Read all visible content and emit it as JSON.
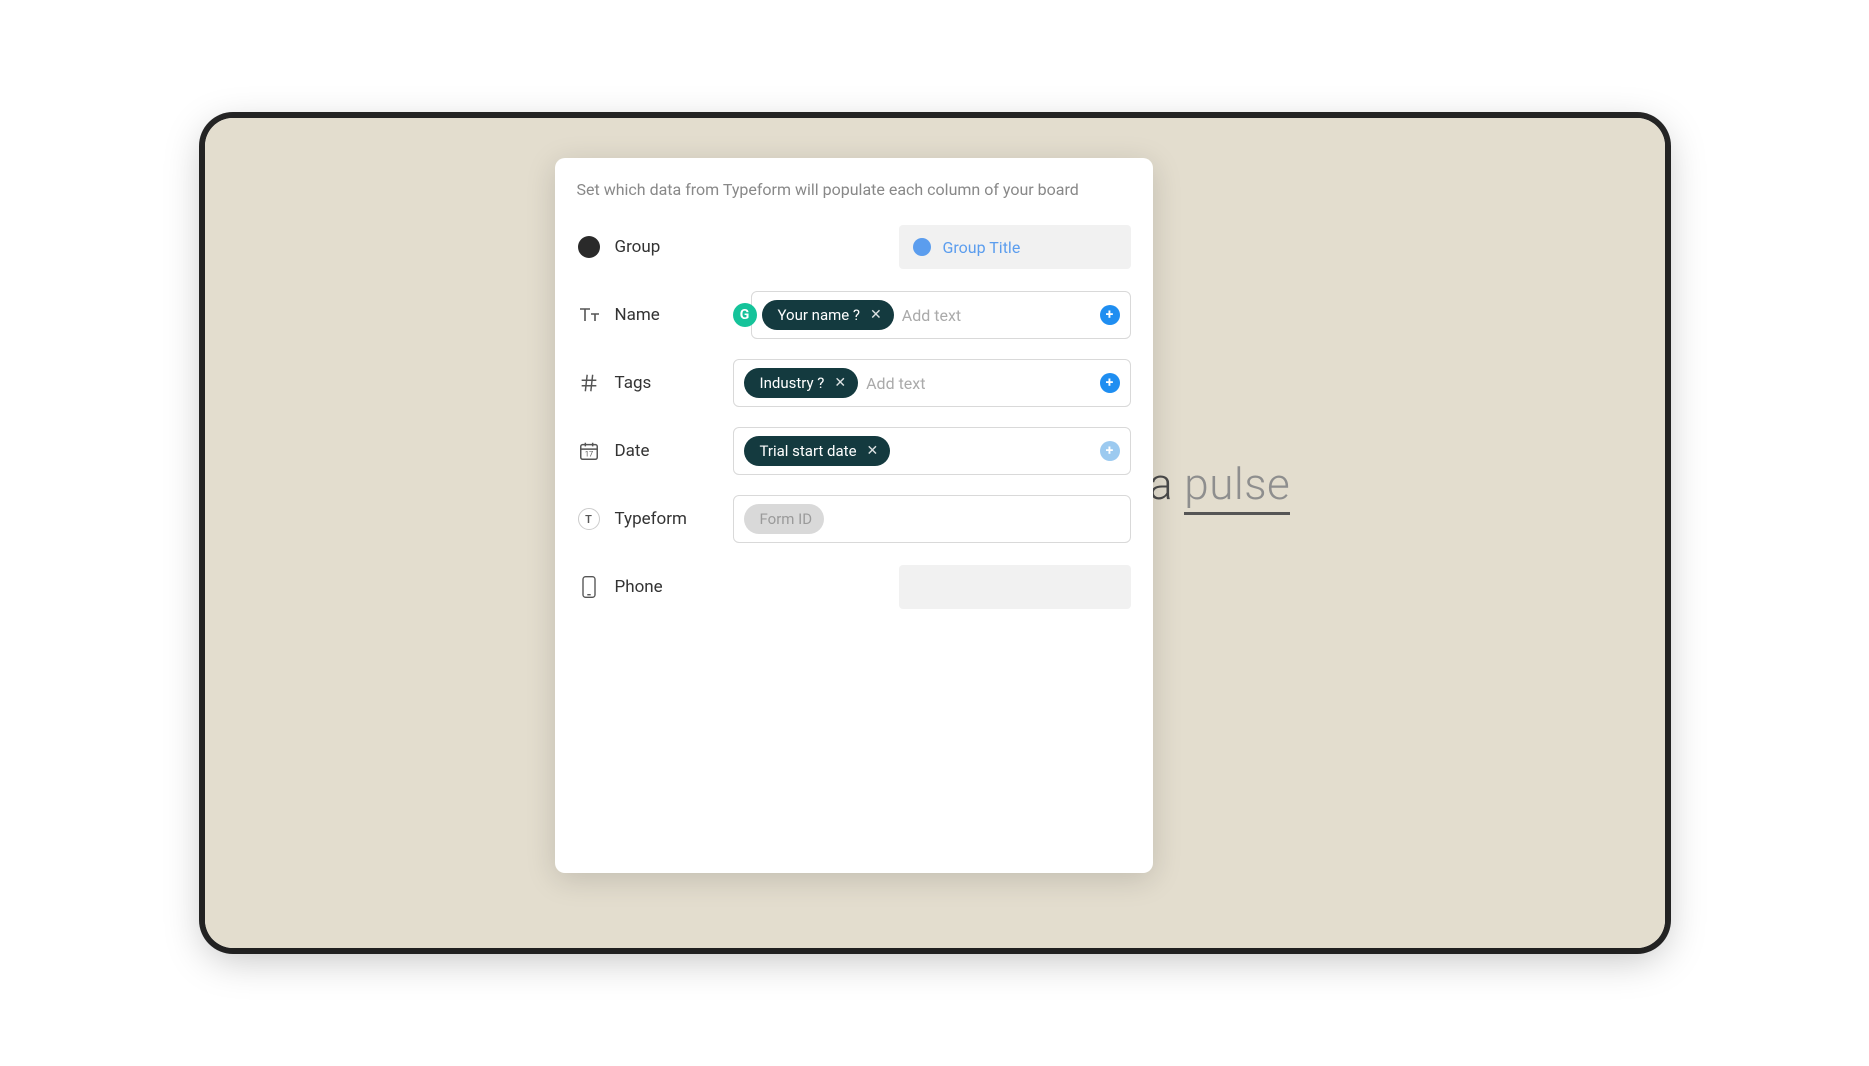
{
  "panel": {
    "description": "Set which data from Typeform will populate each column of your board"
  },
  "background": {
    "text_prefix": "e a ",
    "text_emphasis": "pulse"
  },
  "rows": {
    "group": {
      "label": "Group",
      "title_placeholder": "Group Title"
    },
    "name": {
      "label": "Name",
      "pill": "Your name ?",
      "placeholder": "Add text",
      "grammarly": "G"
    },
    "tags": {
      "label": "Tags",
      "pill": "Industry ?",
      "placeholder": "Add text"
    },
    "date": {
      "label": "Date",
      "pill": "Trial start date"
    },
    "typeform": {
      "label": "Typeform",
      "pill": "Form ID",
      "t_icon": "T"
    },
    "phone": {
      "label": "Phone"
    }
  },
  "icons": {
    "plus": "+",
    "close": "✕"
  }
}
